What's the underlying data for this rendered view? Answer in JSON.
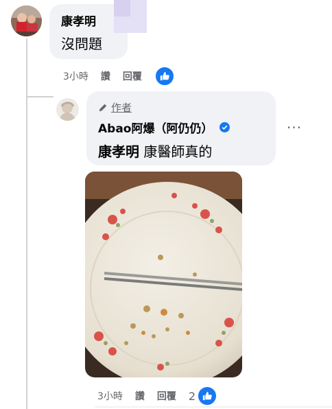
{
  "comment1": {
    "author": "康孝明",
    "text": "沒問題",
    "time": "3小時",
    "action_like": "讚",
    "action_reply": "回覆"
  },
  "reply": {
    "author_tag": "作者",
    "author": "Abao阿爆（阿仍仍）",
    "mention": "康孝明",
    "text": " 康醫師真的",
    "time": "3小時",
    "action_like": "讚",
    "action_reply": "回覆",
    "reaction_count": "2"
  },
  "colors": {
    "like_blue": "#1877f2",
    "bubble_bg": "#f0f2f5",
    "meta_gray": "#65676b"
  }
}
